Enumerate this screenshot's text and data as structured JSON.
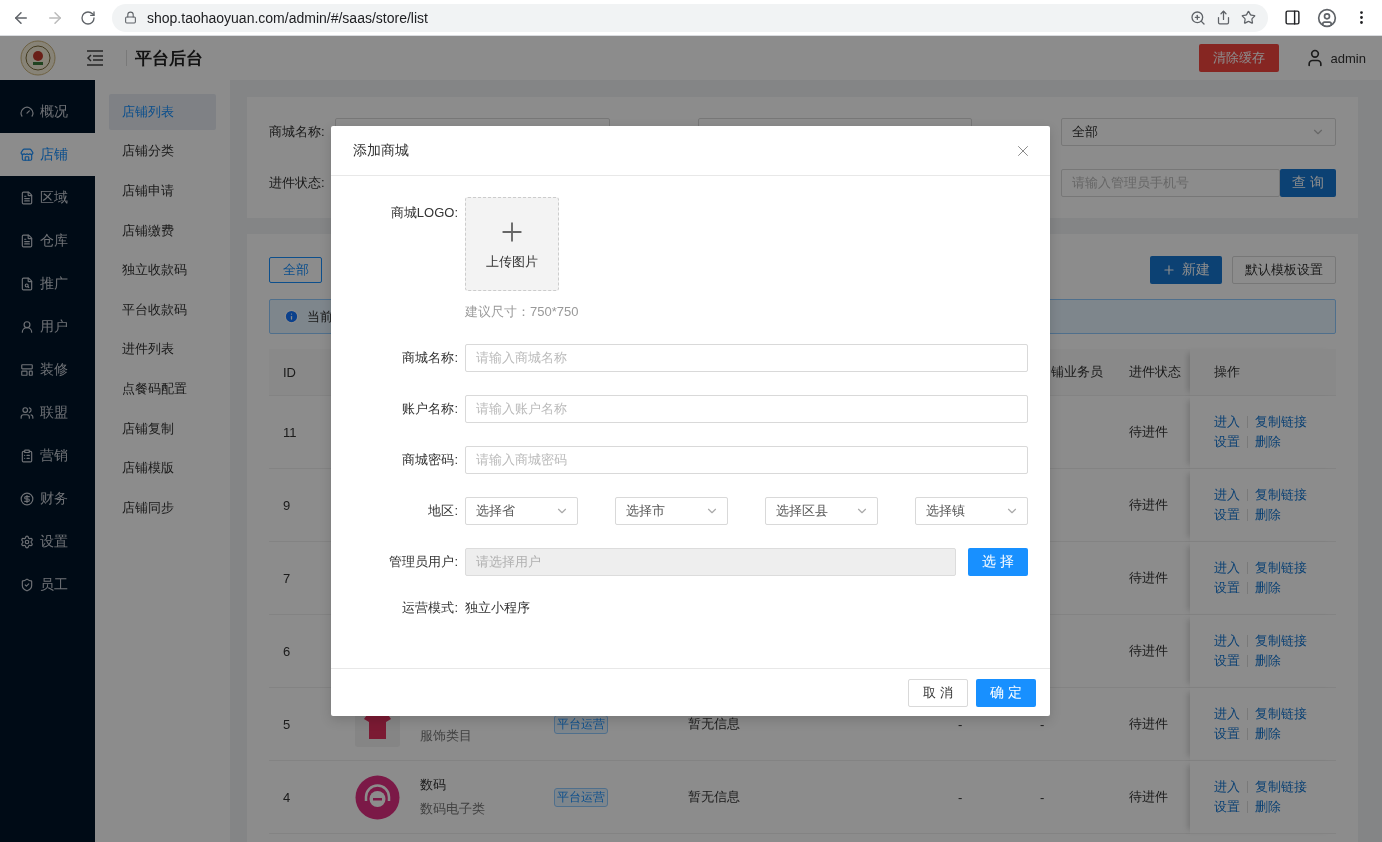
{
  "browser": {
    "url": "shop.taohaoyuan.com/admin/#/saas/store/list"
  },
  "header": {
    "title": "平台后台",
    "clear_cache_button": "清除缓存",
    "user": "admin"
  },
  "sidebar": {
    "items": [
      {
        "label": "概况",
        "selected": false
      },
      {
        "label": "店铺",
        "selected": true
      },
      {
        "label": "区域",
        "selected": false
      },
      {
        "label": "仓库",
        "selected": false
      },
      {
        "label": "推广",
        "selected": false
      },
      {
        "label": "用户",
        "selected": false
      },
      {
        "label": "装修",
        "selected": false
      },
      {
        "label": "联盟",
        "selected": false
      },
      {
        "label": "营销",
        "selected": false
      },
      {
        "label": "财务",
        "selected": false
      },
      {
        "label": "设置",
        "selected": false
      },
      {
        "label": "员工",
        "selected": false
      }
    ]
  },
  "submenu": {
    "items": [
      {
        "label": "店铺列表",
        "selected": true
      },
      {
        "label": "店铺分类",
        "selected": false
      },
      {
        "label": "店铺申请",
        "selected": false
      },
      {
        "label": "店铺缴费",
        "selected": false
      },
      {
        "label": "独立收款码",
        "selected": false
      },
      {
        "label": "平台收款码",
        "selected": false
      },
      {
        "label": "进件列表",
        "selected": false
      },
      {
        "label": "点餐码配置",
        "selected": false
      },
      {
        "label": "店铺复制",
        "selected": false
      },
      {
        "label": "店铺模版",
        "selected": false
      },
      {
        "label": "店铺同步",
        "selected": false
      }
    ]
  },
  "filters": {
    "name_label": "商城名称:",
    "status_label": "进件状态:",
    "status_select": "全部",
    "phone_placeholder": "请输入管理员手机号",
    "search_button": "查 询"
  },
  "toolbar": {
    "tabs": [
      {
        "label": "全部",
        "selected": true
      }
    ],
    "new_button": "新建",
    "template_button": "默认模板设置"
  },
  "alert": {
    "text": "当前"
  },
  "table": {
    "columns": {
      "id": "ID",
      "column_6": "铺业务员",
      "status": "进件状态",
      "actions": "操作"
    },
    "rows": [
      {
        "id": "11",
        "status": "待进件",
        "actions": [
          "进入",
          "复制链接",
          "设置",
          "删除"
        ]
      },
      {
        "id": "9",
        "status": "待进件",
        "actions": [
          "进入",
          "复制链接",
          "设置",
          "删除"
        ]
      },
      {
        "id": "7",
        "status": "待进件",
        "actions": [
          "进入",
          "复制链接",
          "设置",
          "删除"
        ]
      },
      {
        "id": "6",
        "status": "待进件",
        "actions": [
          "进入",
          "复制链接",
          "设置",
          "删除"
        ]
      },
      {
        "id": "5",
        "thumb": {
          "kind": "shirt"
        },
        "category": "服饰类目",
        "tag": "平台运营",
        "info": "暂无信息",
        "column_5": "-",
        "column_6": "-",
        "status": "待进件",
        "actions": [
          "进入",
          "复制链接",
          "设置",
          "删除"
        ]
      },
      {
        "id": "4",
        "thumb": {
          "kind": "headphones"
        },
        "name": "数码",
        "category": "数码电子类",
        "tag": "平台运营",
        "info": "暂无信息",
        "column_5": "-",
        "column_6": "-",
        "status": "待进件",
        "actions": [
          "进入",
          "复制链接",
          "设置",
          "删除"
        ]
      }
    ]
  },
  "modal": {
    "title": "添加商城",
    "logo_label": "商城LOGO:",
    "upload_text": "上传图片",
    "upload_hint": "建议尺寸：750*750",
    "fields": [
      {
        "label": "商城名称:",
        "placeholder": "请输入商城名称"
      },
      {
        "label": "账户名称:",
        "placeholder": "请输入账户名称"
      },
      {
        "label": "商城密码:",
        "placeholder": "请输入商城密码"
      }
    ],
    "region": {
      "label": "地区:",
      "selects": [
        "选择省",
        "选择市",
        "选择区县",
        "选择镇"
      ]
    },
    "admin_user": {
      "label": "管理员用户:",
      "placeholder": "请选择用户",
      "disabled": true,
      "button": "选 择"
    },
    "mode": {
      "label": "运营模式:",
      "value": "独立小程序"
    },
    "cancel_button": "取 消",
    "ok_button": "确 定"
  }
}
